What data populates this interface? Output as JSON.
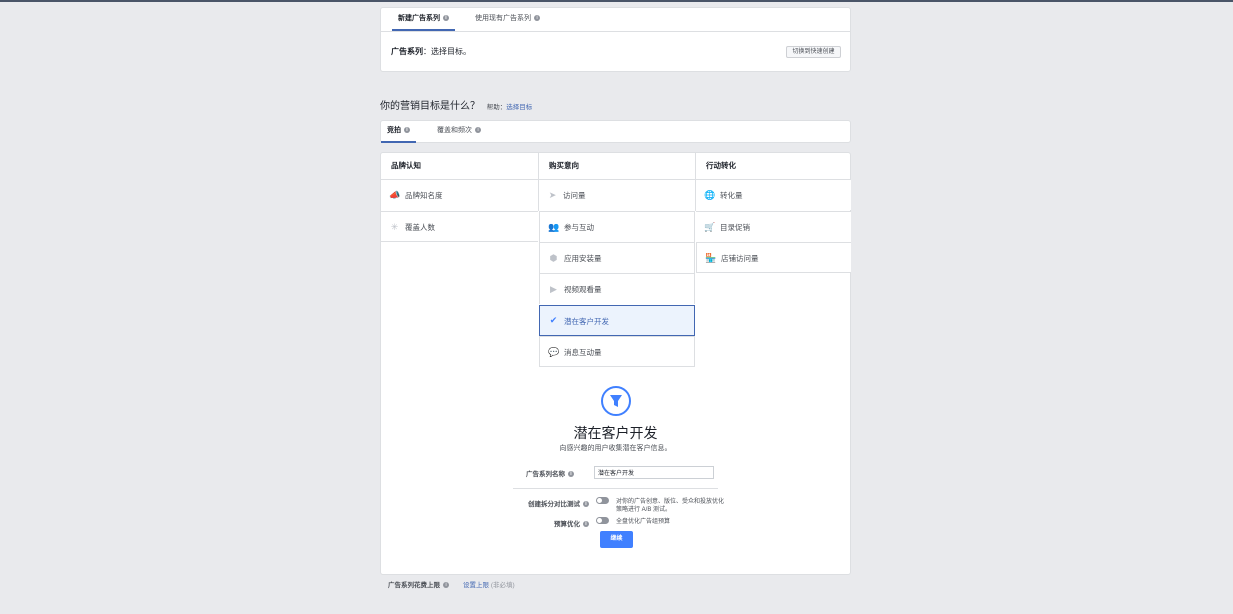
{
  "top_tabs": {
    "new_campaign": "新建广告系列",
    "use_existing": "使用现有广告系列"
  },
  "header": {
    "campaign_label": "广告系列",
    "campaign_text": "：选择目标。",
    "switch_button": "切换到快速创建"
  },
  "objective": {
    "question": "你的营销目标是什么？",
    "help_prefix": "帮助：",
    "help_link": "选择目标"
  },
  "buy_tabs": {
    "auction": "竞拍",
    "reach_frequency": "覆盖和频次"
  },
  "columns": {
    "awareness": "品牌认知",
    "consideration": "购买意向",
    "conversion": "行动转化"
  },
  "awareness_items": [
    "品牌知名度",
    "覆盖人数"
  ],
  "consideration_items": [
    "访问量",
    "参与互动",
    "应用安装量",
    "视频观看量",
    "潜在客户开发",
    "消息互动量"
  ],
  "conversion_items": [
    "转化量",
    "目录促销",
    "店铺访问量"
  ],
  "selected": {
    "title": "潜在客户开发",
    "description": "向感兴趣的用户收集潜在客户信息。"
  },
  "form": {
    "name_label": "广告系列名称",
    "name_value": "潜在客户开发",
    "split_test_label": "创建拆分对比测试",
    "split_test_desc_line1": "对你的广告创意、版位、受众和投放优化",
    "split_test_desc_line2": "策略进行 A/B 测试。",
    "budget_opt_label": "预算优化",
    "budget_opt_desc": "全盘优化广告组预算",
    "continue_button": "继续"
  },
  "footer": {
    "spend_limit_label": "广告系列花费上限",
    "set_limit_link": "设置上限",
    "optional": "(非必填)"
  },
  "colors": {
    "accent": "#4267b2",
    "button_blue": "#4080ff",
    "page_bg": "#e9eaed"
  }
}
